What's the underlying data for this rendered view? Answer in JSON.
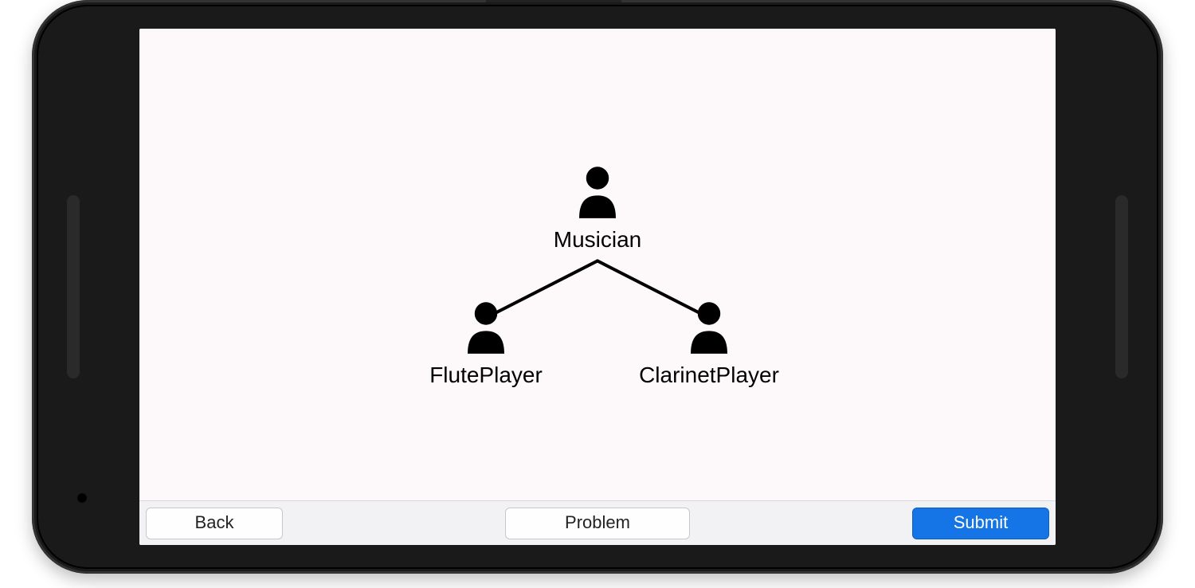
{
  "diagram": {
    "parent": {
      "label": "Musician"
    },
    "children": [
      {
        "label": "FlutePlayer"
      },
      {
        "label": "ClarinetPlayer"
      }
    ]
  },
  "toolbar": {
    "back_label": "Back",
    "problem_label": "Problem",
    "submit_label": "Submit"
  },
  "colors": {
    "screen_bg": "#fdf9fb",
    "toolbar_bg": "#f2f2f4",
    "submit_bg": "#1574e6"
  }
}
